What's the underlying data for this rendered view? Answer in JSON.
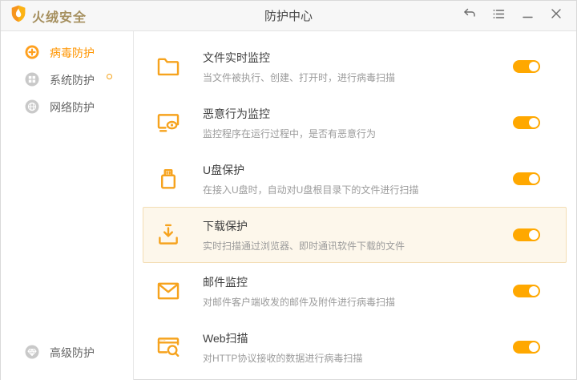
{
  "titlebar": {
    "logo_text": "火绒安全",
    "title": "防护中心",
    "controls": [
      {
        "name": "back",
        "icon": "undo-arrow-icon"
      },
      {
        "name": "menu",
        "icon": "menu-list-icon"
      },
      {
        "name": "minimize",
        "icon": "minimize-icon"
      },
      {
        "name": "close",
        "icon": "close-icon"
      }
    ]
  },
  "sidebar": {
    "items": [
      {
        "label": "病毒防护",
        "icon": "virus-cross-icon",
        "active": true,
        "badge": false
      },
      {
        "label": "系统防护",
        "icon": "system-windows-icon",
        "active": false,
        "badge": true
      },
      {
        "label": "网络防护",
        "icon": "network-globe-icon",
        "active": false,
        "badge": false
      }
    ],
    "bottom_item": {
      "label": "高级防护",
      "icon": "advanced-gem-icon"
    }
  },
  "protections": [
    {
      "icon": "folder-icon",
      "title": "文件实时监控",
      "desc": "当文件被执行、创建、打开时，进行病毒扫描",
      "enabled": true,
      "highlighted": false
    },
    {
      "icon": "behavior-monitor-icon",
      "title": "恶意行为监控",
      "desc": "监控程序在运行过程中，是否有恶意行为",
      "enabled": true,
      "highlighted": false
    },
    {
      "icon": "usb-drive-icon",
      "title": "U盘保护",
      "desc": "在接入U盘时，自动对U盘根目录下的文件进行扫描",
      "enabled": true,
      "highlighted": false
    },
    {
      "icon": "download-icon",
      "title": "下载保护",
      "desc": "实时扫描通过浏览器、即时通讯软件下载的文件",
      "enabled": true,
      "highlighted": true
    },
    {
      "icon": "mail-icon",
      "title": "邮件监控",
      "desc": "对邮件客户端收发的邮件及附件进行病毒扫描",
      "enabled": true,
      "highlighted": false
    },
    {
      "icon": "web-scan-icon",
      "title": "Web扫描",
      "desc": "对HTTP协议接收的数据进行病毒扫描",
      "enabled": true,
      "highlighted": false
    }
  ],
  "colors": {
    "accent": "#FFA800",
    "icon_orange": "#F6A31E",
    "active_text": "#FF9500",
    "highlight_bg": "#FDF7EB",
    "highlight_border": "#F3DDB4",
    "logo_text": "#A58F5E"
  }
}
